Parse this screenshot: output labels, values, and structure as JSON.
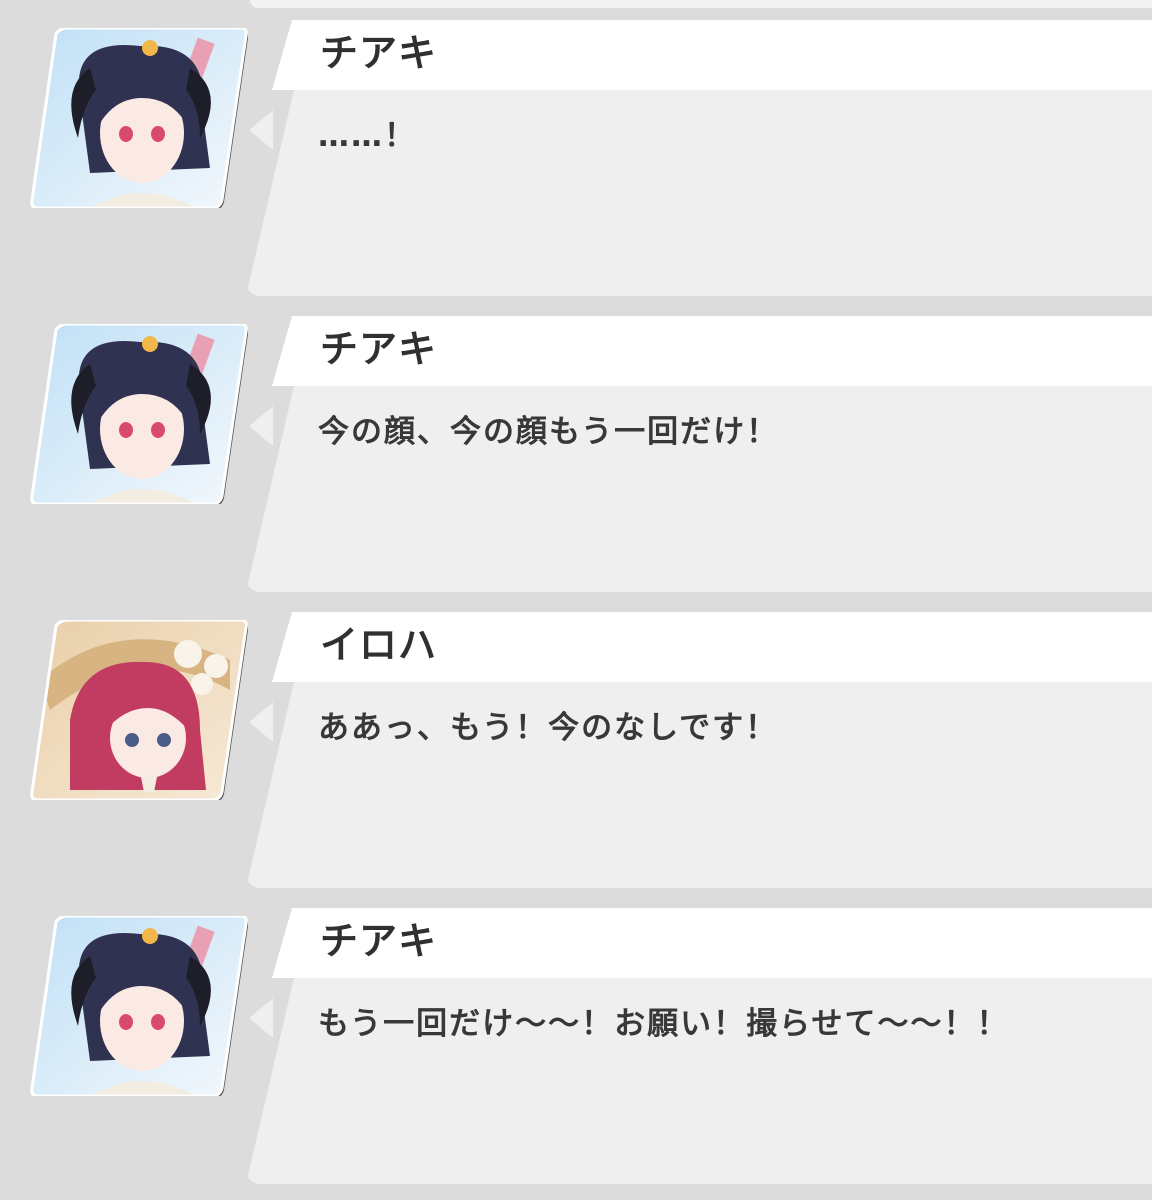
{
  "dialogue": [
    {
      "speaker": "チアキ",
      "text": "……！",
      "avatar": "chiaki-portrait"
    },
    {
      "speaker": "チアキ",
      "text": "今の顔、今の顔もう一回だけ！",
      "avatar": "chiaki-portrait"
    },
    {
      "speaker": "イロハ",
      "text": "ああっ、もう！今のなしです！",
      "avatar": "iroha-portrait"
    },
    {
      "speaker": "チアキ",
      "text": "もう一回だけ〜〜！お願い！撮らせて〜〜！！",
      "avatar": "chiaki-portrait"
    }
  ],
  "colors": {
    "background": "#dcdcdc",
    "bubble": "#efefef",
    "name_tab": "#ffffff",
    "text": "#383838",
    "chiaki_hair": "#2f3250",
    "iroha_hair": "#c23c62"
  }
}
